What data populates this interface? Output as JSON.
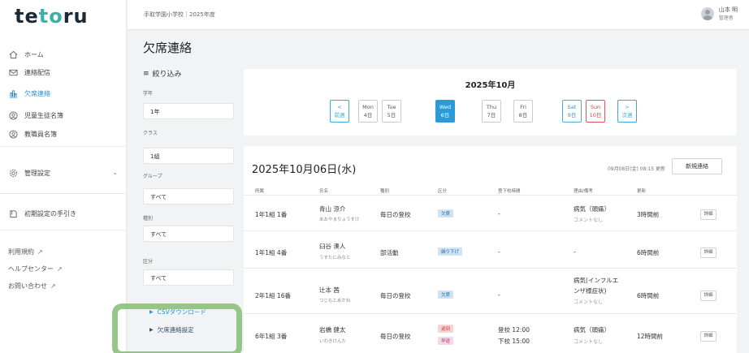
{
  "app": {
    "logo": "tetoru",
    "school": "手取学園小学校｜2025年度",
    "user_name": "山本 明",
    "user_role": "管理者"
  },
  "sidebar": {
    "items": [
      {
        "label": "ホーム",
        "icon": "home-icon"
      },
      {
        "label": "連絡配信",
        "icon": "mail-icon"
      },
      {
        "label": "欠席連絡",
        "icon": "attendance-icon"
      },
      {
        "label": "児童生徒名簿",
        "icon": "student-icon"
      },
      {
        "label": "教職員名簿",
        "icon": "staff-icon"
      },
      {
        "label": "管理設定",
        "icon": "gear-icon"
      },
      {
        "label": "初期設定の手引き",
        "icon": "book-icon"
      }
    ],
    "links": [
      "利用規約",
      "ヘルプセンター",
      "お問い合わせ"
    ]
  },
  "page": {
    "title": "欠席連絡"
  },
  "filter": {
    "heading": "絞り込み",
    "fields": [
      {
        "label": "学年",
        "value": "1年"
      },
      {
        "label": "クラス",
        "value": "1組"
      },
      {
        "label": "グループ",
        "value": "すべて"
      },
      {
        "label": "種別",
        "value": "すべて"
      },
      {
        "label": "区分",
        "value": "すべて"
      }
    ],
    "links": [
      "CSVダウンロード",
      "欠席連絡設定"
    ]
  },
  "calendar": {
    "title": "2025年10月",
    "prev": {
      "top": "<",
      "bottom": "前週"
    },
    "next": {
      "top": ">",
      "bottom": "次週"
    },
    "days": [
      {
        "dow": "Mon",
        "date": "4日",
        "kind": "normal"
      },
      {
        "dow": "Tue",
        "date": "5日",
        "kind": "normal"
      },
      {
        "dow": "Wed",
        "date": "6日",
        "kind": "selected"
      },
      {
        "dow": "Thu",
        "date": "7日",
        "kind": "normal"
      },
      {
        "dow": "Fri",
        "date": "8日",
        "kind": "normal"
      },
      {
        "dow": "Sat",
        "date": "9日",
        "kind": "sat"
      },
      {
        "dow": "Sun",
        "date": "10日",
        "kind": "sun"
      }
    ]
  },
  "table": {
    "date": "2025年10月06日(水)",
    "updated": "09月08日(金) 08:15 更新",
    "new_button": "新規連絡",
    "headers": [
      "所属",
      "氏名",
      "種別",
      "区分",
      "登下校時間",
      "理由/備考",
      "更新"
    ],
    "rows": [
      {
        "class": "1年1組 1番",
        "name": "青山 涼介",
        "kana": "あおやまりょうすけ",
        "type": "毎日の登校",
        "badges": [
          {
            "text": "欠席",
            "kind": "absent"
          }
        ],
        "time": [
          "-"
        ],
        "reason": [
          "病気（頭痛）"
        ],
        "note": "コメントなし",
        "updated": "3時間前",
        "detail": "詳細"
      },
      {
        "class": "1年1組 4番",
        "name": "臼谷 湊人",
        "kana": "うすたにみなと",
        "type": "部活動",
        "badges": [
          {
            "text": "繰り下げ",
            "kind": "absent"
          }
        ],
        "time": [
          "-"
        ],
        "reason": [
          "-"
        ],
        "note": "コメントなし",
        "updated": "6時間前",
        "detail": "詳細"
      },
      {
        "class": "2年1組 16番",
        "name": "辻本 茜",
        "kana": "つじもとあかね",
        "type": "毎日の登校",
        "badges": [
          {
            "text": "欠席",
            "kind": "absent"
          }
        ],
        "time": [
          "-"
        ],
        "reason": [
          "病気(インフルエ",
          "ンザ様症状)"
        ],
        "note": "コメントなし",
        "updated": "6時間前",
        "detail": "詳細"
      },
      {
        "class": "6年1組 3番",
        "name": "岩橋 健太",
        "kana": "いわきけんた",
        "type": "毎日の登校",
        "badges": [
          {
            "text": "遅刻",
            "kind": "late"
          },
          {
            "text": "早退",
            "kind": "early"
          }
        ],
        "time": [
          "登校 12:00",
          "下校 15:00"
        ],
        "reason": [
          "病気（頭痛）"
        ],
        "note": "コメントなし",
        "updated": "12時間前",
        "detail": "詳細"
      }
    ]
  }
}
